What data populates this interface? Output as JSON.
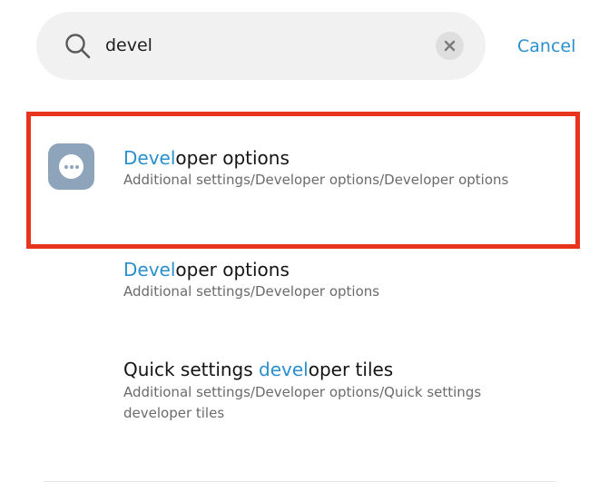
{
  "search": {
    "query": "devel",
    "cancel_label": "Cancel"
  },
  "results": [
    {
      "title_highlight": "Devel",
      "title_rest": "oper options",
      "path": "Additional settings/Developer options/Developer options"
    },
    {
      "title_highlight": "Devel",
      "title_rest": "oper options",
      "path": "Additional settings/Developer options"
    },
    {
      "title_prefix": "Quick settings ",
      "title_highlight": "devel",
      "title_rest": "oper tiles",
      "path": "Additional settings/Developer options/Quick settings developer tiles"
    }
  ],
  "colors": {
    "accent": "#2a8fcd",
    "highlight_box": "#e8341c",
    "icon_background": "#8ea4bb"
  },
  "icons": {
    "search": "search-icon",
    "clear": "close-icon",
    "result_app": "more-dots-icon"
  }
}
